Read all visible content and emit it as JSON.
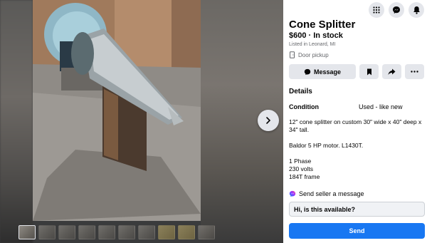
{
  "listing": {
    "title": "Cone Splitter",
    "price_stock": "$600 · In stock",
    "listed_in": "Listed in Leonard, MI",
    "pickup": "Door pickup"
  },
  "actions": {
    "message_label": "Message"
  },
  "details": {
    "heading": "Details",
    "condition_label": "Condition",
    "condition_value": "Used - like new",
    "description": [
      "12\" cone splitter on custom 30\" wide x 40\" deep x 34\" tall.",
      "Baldor 5 HP motor.  L1430T.",
      "1 Phase\n230 volts\n184T frame"
    ]
  },
  "messaging": {
    "send_seller_label": "Send seller a message",
    "input_value": "Hi, is this available?",
    "send_label": "Send"
  },
  "icons": {
    "menu": "grid-icon",
    "messenger": "messenger-icon",
    "bell": "bell-icon",
    "next": "chevron-right-icon",
    "save": "bookmark-icon",
    "share": "share-icon",
    "more": "more-icon",
    "pickup": "door-icon"
  },
  "colors": {
    "accent": "#1877f2"
  }
}
